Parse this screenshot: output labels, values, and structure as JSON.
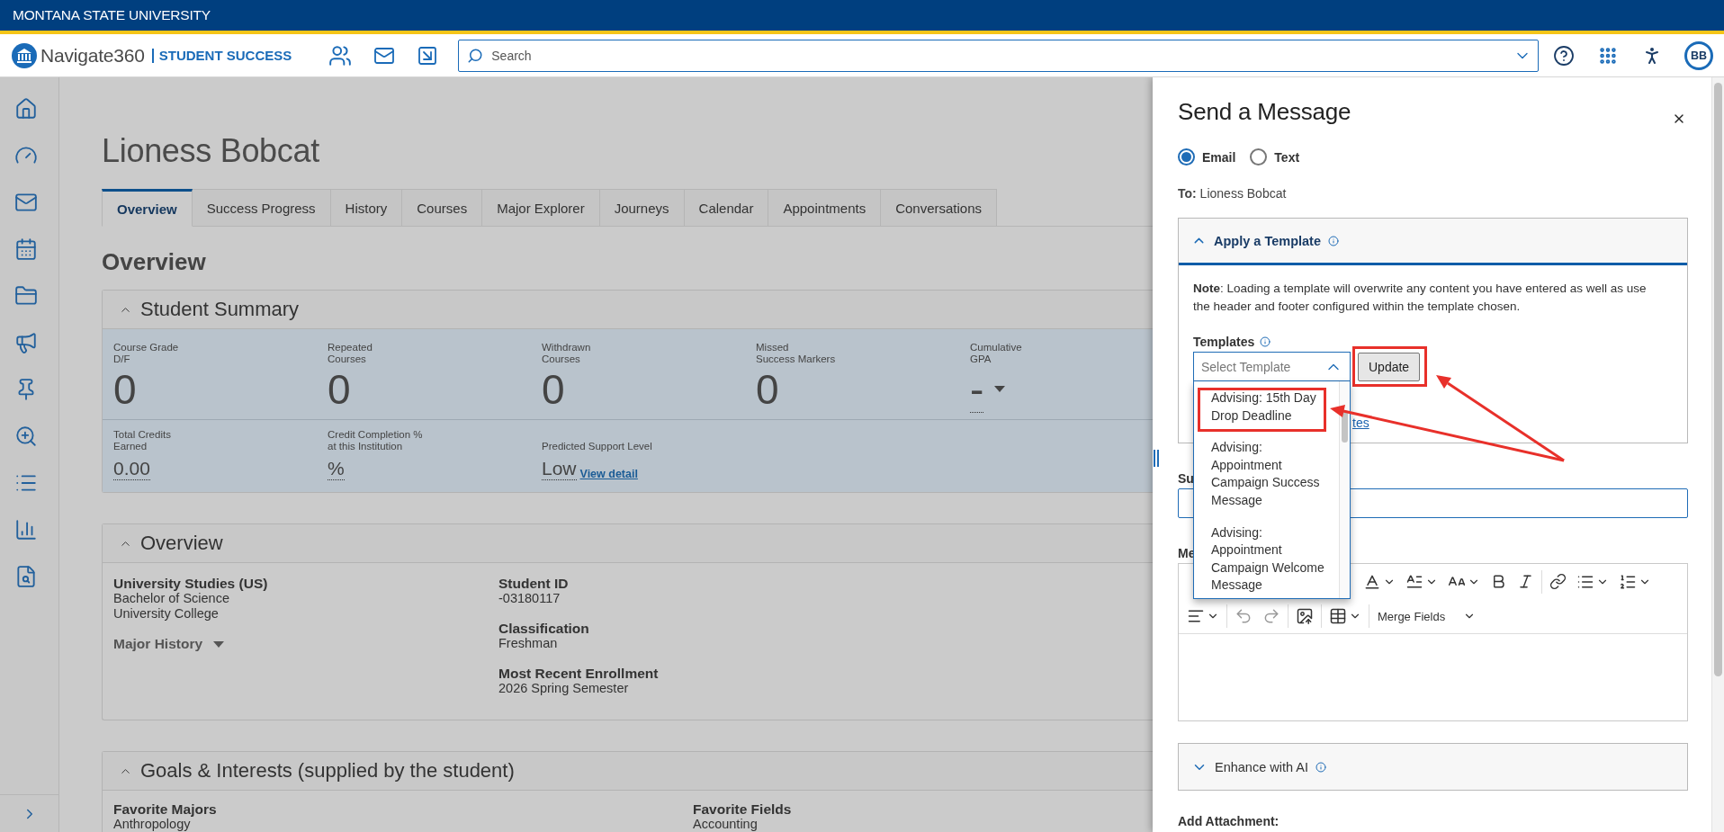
{
  "university_bar": {
    "title": "MONTANA STATE UNIVERSITY"
  },
  "header": {
    "brand": "Navigate360",
    "product": "STUDENT SUCCESS",
    "search": {
      "placeholder": "Search"
    },
    "avatar": "BB"
  },
  "student": {
    "name": "Lioness Bobcat"
  },
  "tabs": [
    {
      "label": "Overview",
      "selected": true
    },
    {
      "label": "Success Progress",
      "selected": false
    },
    {
      "label": "History",
      "selected": false
    },
    {
      "label": "Courses",
      "selected": false
    },
    {
      "label": "Major Explorer",
      "selected": false
    },
    {
      "label": "Journeys",
      "selected": false
    },
    {
      "label": "Calendar",
      "selected": false
    },
    {
      "label": "Appointments",
      "selected": false
    },
    {
      "label": "Conversations",
      "selected": false
    }
  ],
  "section_heading": "Overview",
  "student_summary": {
    "title": "Student Summary",
    "expanded": true,
    "metrics": [
      {
        "label": "Course Grade\nD/F",
        "value": "0",
        "kind": "count"
      },
      {
        "label": "Repeated\nCourses",
        "value": "0",
        "kind": "count"
      },
      {
        "label": "Withdrawn\nCourses",
        "value": "0",
        "kind": "count"
      },
      {
        "label": "Missed\nSuccess Markers",
        "value": "0",
        "kind": "count"
      },
      {
        "label": "Cumulative\nGPA",
        "value": "-",
        "kind": "menu"
      }
    ],
    "details": [
      {
        "label": "Total Credits\nEarned",
        "value": "0.00",
        "kind": "hint"
      },
      {
        "label": "Credit Completion %\nat this Institution",
        "value": "%",
        "kind": "hint"
      },
      {
        "label": "Predicted Support Level",
        "value": "Low",
        "kind": "hint",
        "link": "View detail"
      }
    ]
  },
  "overview": {
    "title": "Overview",
    "expanded": true,
    "program": {
      "major": "University Studies (US)",
      "degree": "Bachelor of Science",
      "college": "University College",
      "history_label": "Major History"
    },
    "facts": [
      {
        "label": "Student ID",
        "value": "-03180117"
      },
      {
        "label": "Classification",
        "value": "Freshman"
      },
      {
        "label": "Most Recent Enrollment",
        "value": "2026 Spring Semester"
      }
    ]
  },
  "goals": {
    "title": "Goals & Interests (supplied by the student)",
    "expanded": true,
    "fields": [
      {
        "label": "Favorite Majors",
        "value": "Anthropology"
      },
      {
        "label": "Favorite Fields",
        "value": "Accounting"
      }
    ]
  },
  "drawer": {
    "title": "Send a Message",
    "channels": [
      {
        "label": "Email",
        "selected": true
      },
      {
        "label": "Text",
        "selected": false
      }
    ],
    "to": "**To:** Lioness Bobcat",
    "template_section": {
      "title": "Apply a Template",
      "expanded": true,
      "note": "**Note**: Loading a template will overwrite any content you have entered as well as use the header and footer configured within the template chosen.",
      "templates_label": "Templates",
      "select": {
        "placeholder": "Select Template",
        "open": true
      },
      "options": [
        {
          "label": "Advising: 15th Day Drop Deadline",
          "selected": false,
          "highlighted": true
        },
        {
          "label": "Advising: Appointment Campaign Success Message",
          "selected": false,
          "highlighted": false
        },
        {
          "label": "Advising: Appointment Campaign Welcome Message",
          "selected": false,
          "highlighted": false
        }
      ],
      "update_button": {
        "label": "Update",
        "highlighted": true
      },
      "link_fragment": "tes"
    },
    "subject": {
      "label": "Su"
    },
    "message": {
      "label": "Me",
      "merge_fields": "Merge Fields"
    },
    "ai_section": {
      "title": "Enhance with AI",
      "expanded": false
    },
    "attachment": {
      "label": "Add Attachment:"
    }
  }
}
